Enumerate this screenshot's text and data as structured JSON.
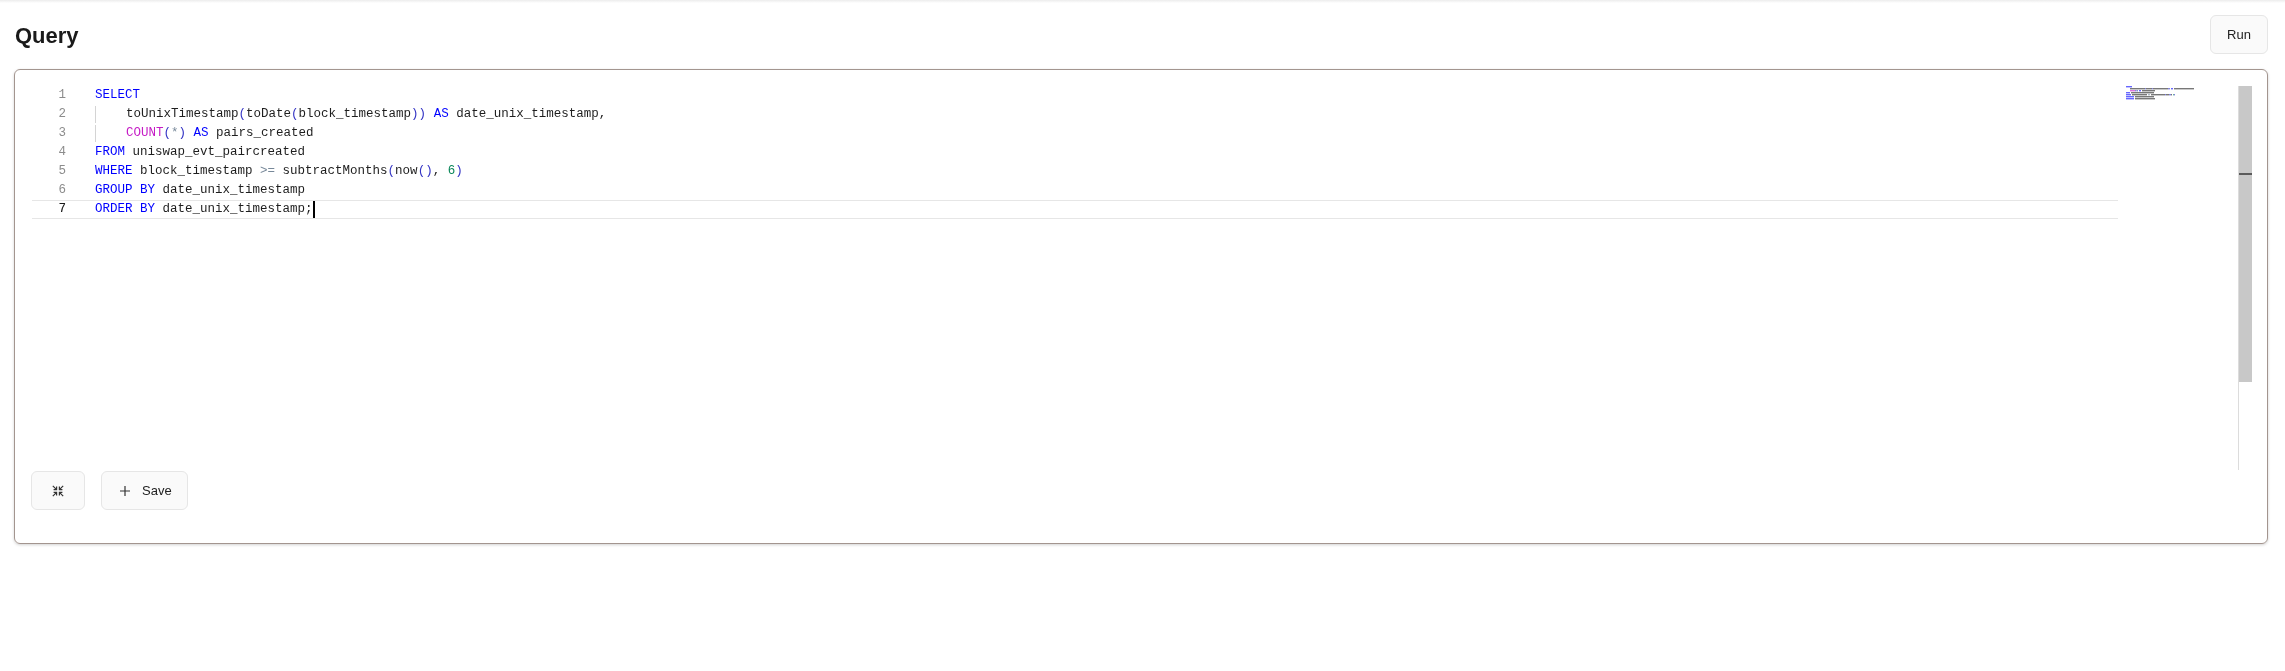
{
  "header": {
    "title": "Query",
    "run_button": "Run"
  },
  "editor": {
    "lines": [
      {
        "number": "1",
        "indented": false,
        "current": false,
        "tokens": [
          {
            "text": "SELECT",
            "kind": "keyword"
          }
        ]
      },
      {
        "number": "2",
        "indented": true,
        "current": false,
        "tokens": [
          {
            "text": "toUnixTimestamp",
            "kind": "identifier"
          },
          {
            "text": "(",
            "kind": "paren"
          },
          {
            "text": "toDate",
            "kind": "identifier"
          },
          {
            "text": "(",
            "kind": "paren"
          },
          {
            "text": "block_timestamp",
            "kind": "identifier"
          },
          {
            "text": "))",
            "kind": "paren"
          },
          {
            "text": " AS ",
            "kind": "keyword"
          },
          {
            "text": "date_unix_timestamp,",
            "kind": "identifier"
          }
        ]
      },
      {
        "number": "3",
        "indented": true,
        "current": false,
        "tokens": [
          {
            "text": "COUNT",
            "kind": "predefined"
          },
          {
            "text": "(",
            "kind": "paren"
          },
          {
            "text": "*",
            "kind": "operator"
          },
          {
            "text": ")",
            "kind": "paren"
          },
          {
            "text": " AS ",
            "kind": "keyword"
          },
          {
            "text": "pairs_created",
            "kind": "identifier"
          }
        ]
      },
      {
        "number": "4",
        "indented": false,
        "current": false,
        "tokens": [
          {
            "text": "FROM",
            "kind": "keyword"
          },
          {
            "text": " uniswap_evt_paircreated",
            "kind": "identifier"
          }
        ]
      },
      {
        "number": "5",
        "indented": false,
        "current": false,
        "tokens": [
          {
            "text": "WHERE",
            "kind": "keyword"
          },
          {
            "text": " block_timestamp ",
            "kind": "identifier"
          },
          {
            "text": ">=",
            "kind": "operator"
          },
          {
            "text": " subtractMonths",
            "kind": "identifier"
          },
          {
            "text": "(",
            "kind": "paren"
          },
          {
            "text": "now",
            "kind": "identifier"
          },
          {
            "text": "()",
            "kind": "paren"
          },
          {
            "text": ", ",
            "kind": "identifier"
          },
          {
            "text": "6",
            "kind": "number"
          },
          {
            "text": ")",
            "kind": "paren"
          }
        ]
      },
      {
        "number": "6",
        "indented": false,
        "current": false,
        "tokens": [
          {
            "text": "GROUP BY",
            "kind": "keyword"
          },
          {
            "text": " date_unix_timestamp",
            "kind": "identifier"
          }
        ]
      },
      {
        "number": "7",
        "indented": false,
        "current": true,
        "tokens": [
          {
            "text": "ORDER BY",
            "kind": "keyword"
          },
          {
            "text": " date_unix_timestamp;",
            "kind": "identifier"
          }
        ]
      }
    ]
  },
  "actions": {
    "save_button": "Save"
  }
}
